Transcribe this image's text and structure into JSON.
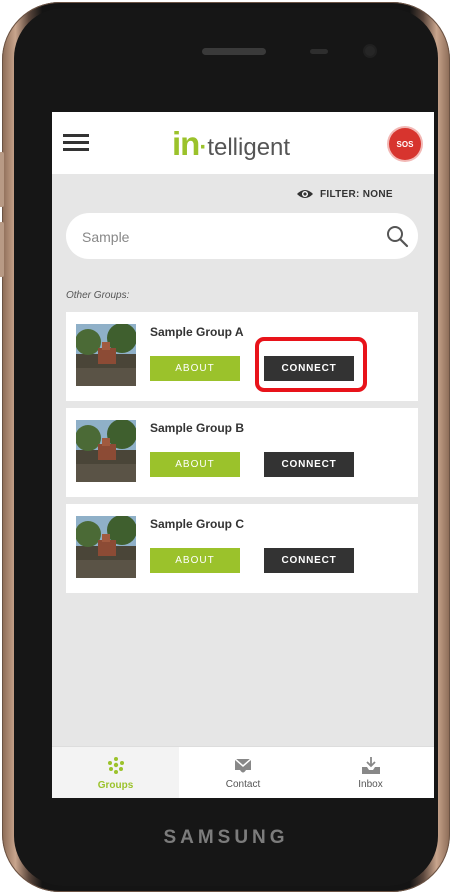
{
  "device": {
    "brand": "SAMSUNG"
  },
  "header": {
    "logo_prefix": "in",
    "logo_suffix": "telligent",
    "sos_label": "SOS"
  },
  "filter": {
    "label": "FILTER: NONE"
  },
  "search": {
    "value": "Sample"
  },
  "section": {
    "label": "Other Groups:"
  },
  "groups": [
    {
      "name": "Sample Group A",
      "about_label": "ABOUT",
      "connect_label": "CONNECT"
    },
    {
      "name": "Sample Group B",
      "about_label": "ABOUT",
      "connect_label": "CONNECT"
    },
    {
      "name": "Sample Group C",
      "about_label": "ABOUT",
      "connect_label": "CONNECT"
    }
  ],
  "bottom_nav": [
    {
      "label": "Groups",
      "icon": "groups-icon",
      "active": true
    },
    {
      "label": "Contact",
      "icon": "contact-icon",
      "active": false
    },
    {
      "label": "Inbox",
      "icon": "inbox-icon",
      "active": false
    }
  ],
  "colors": {
    "accent": "#9bc22b",
    "dark_button": "#333333",
    "highlight": "#e8131a",
    "sos": "#d7342e"
  }
}
